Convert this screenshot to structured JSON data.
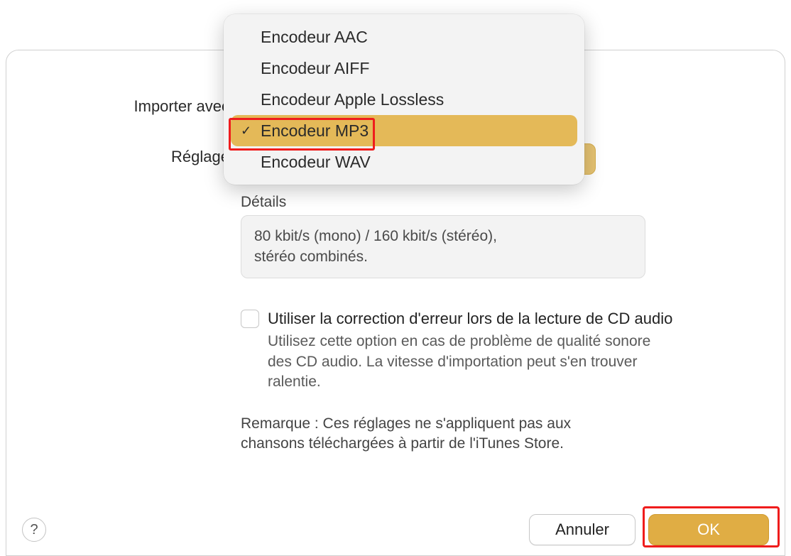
{
  "labels": {
    "import_with": "Importer avec",
    "setting": "Réglage"
  },
  "encoder_options": [
    {
      "label": "Encodeur AAC",
      "selected": false
    },
    {
      "label": "Encodeur AIFF",
      "selected": false
    },
    {
      "label": "Encodeur Apple Lossless",
      "selected": false
    },
    {
      "label": "Encodeur MP3",
      "selected": true
    },
    {
      "label": "Encodeur WAV",
      "selected": false
    }
  ],
  "details": {
    "heading": "Détails",
    "line1": "80 kbit/s (mono) / 160 kbit/s (stéréo),",
    "line2": "stéréo combinés."
  },
  "error_correction": {
    "label": "Utiliser la correction d'erreur lors de la lecture de CD audio",
    "description": "Utilisez cette option en cas de problème de qualité sonore des CD audio. La vitesse d'importation peut s'en trouver ralentie."
  },
  "note": "Remarque : Ces réglages ne s'appliquent pas aux chansons téléchargées à partir de l'iTunes Store.",
  "footer": {
    "help_label": "?",
    "cancel_label": "Annuler",
    "ok_label": "OK"
  },
  "colors": {
    "accent": "#e0ad44",
    "highlight": "#ef1c1c"
  }
}
